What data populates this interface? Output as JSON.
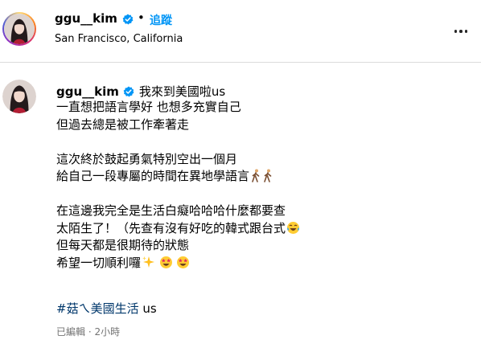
{
  "header": {
    "username": "ggu__kim",
    "separator": "•",
    "follow_label": "追蹤",
    "location": "San Francisco, California"
  },
  "post": {
    "username": "ggu__kim",
    "caption_first": "我來到美國啦us",
    "lines": [
      "一直想把語言學好 也想多充實自己",
      "但過去總是被工作牽著走",
      "",
      "這次終於鼓起勇氣特別空出一個月",
      "給自己一段專屬的時間在異地學語言",
      "",
      "在這邊我完全是生活白癡哈哈哈什麼都要查",
      "太陌生了！（先查有沒有好吃的韓式跟台式",
      "但每天都是很期待的狀態",
      "希望一切順利囉"
    ],
    "hashtag": "#菇ㄟ美國生活",
    "hashtag_suffix": " us",
    "meta": "已編輯 · 2小時"
  },
  "colors": {
    "link_blue": "#0095f6",
    "hashtag_blue": "#00376b",
    "meta_gray": "#737373",
    "verified_blue": "#0095f6"
  },
  "icons": {
    "verified": "verified-badge-icon",
    "more": "more-options-icon",
    "walking": "person-walking-emoji",
    "laughing": "tears-of-joy-emoji",
    "sparkles": "sparkles-emoji",
    "star_struck": "star-struck-emoji"
  }
}
